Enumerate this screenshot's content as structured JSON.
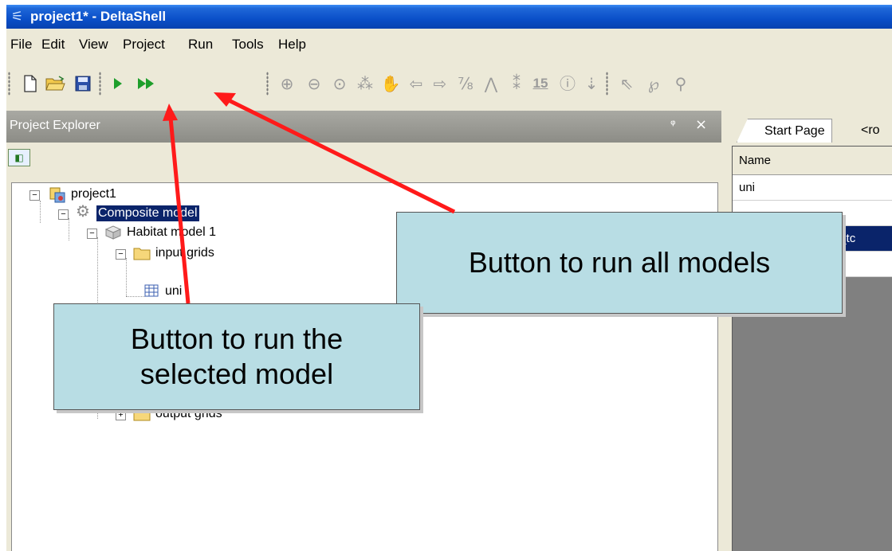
{
  "window": {
    "title": "project1* - DeltaShell"
  },
  "menu": [
    "File",
    "Edit",
    "View",
    "Project",
    "Run",
    "Tools",
    "Help"
  ],
  "toolbar": {
    "file_group": [
      "new-file-icon",
      "open-folder-icon",
      "save-disk-icon"
    ],
    "run_group": [
      "run-selected-icon",
      "run-all-icon"
    ],
    "map_group": [
      "zoom-in-icon",
      "zoom-out-icon",
      "zoom-extent-icon",
      "layers-icon",
      "pan-hand-icon",
      "back-arrow-icon",
      "forward-arrow-icon",
      "measure-icon",
      "north-arrow-icon",
      "label-icon"
    ],
    "count_value": "15",
    "extra_group": [
      "info-icon",
      "import-icon",
      "select-pointer-icon",
      "lasso-icon",
      "vertex-edit-icon"
    ]
  },
  "project_explorer": {
    "title": "Project Explorer",
    "pin_glyph": "ᵠ",
    "close_glyph": "×",
    "tree": [
      {
        "label": "project1",
        "icon": "project-icon"
      },
      {
        "label": "Composite model",
        "icon": "gear-icon",
        "selected": true
      },
      {
        "label": "Habitat model 1",
        "icon": "model-icon"
      },
      {
        "label": "input grids",
        "icon": "folder-icon"
      },
      {
        "label": "uni",
        "icon": "grid-icon"
      },
      {
        "label": "output grids",
        "icon": "folder-icon"
      }
    ]
  },
  "document_area": {
    "tabs": [
      "Start Page",
      "<ro"
    ],
    "grid": {
      "column_header": "Name",
      "rows": [
        "uni",
        "",
        "ked_tc"
      ]
    }
  },
  "annotations": {
    "callout_all": "Button to run all models",
    "callout_selected": "Button to run the\nselected model"
  }
}
